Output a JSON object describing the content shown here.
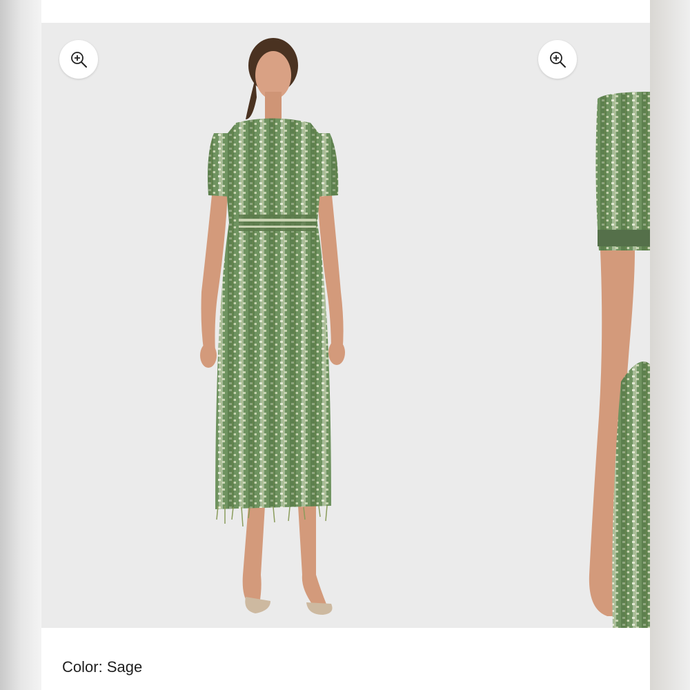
{
  "gallery": {
    "zoom_icon": "zoom-in-icon",
    "background_color": "#ebebeb",
    "dress_color": "#6d8e5b"
  },
  "product": {
    "color_label": "Color:",
    "color_value": "Sage"
  }
}
